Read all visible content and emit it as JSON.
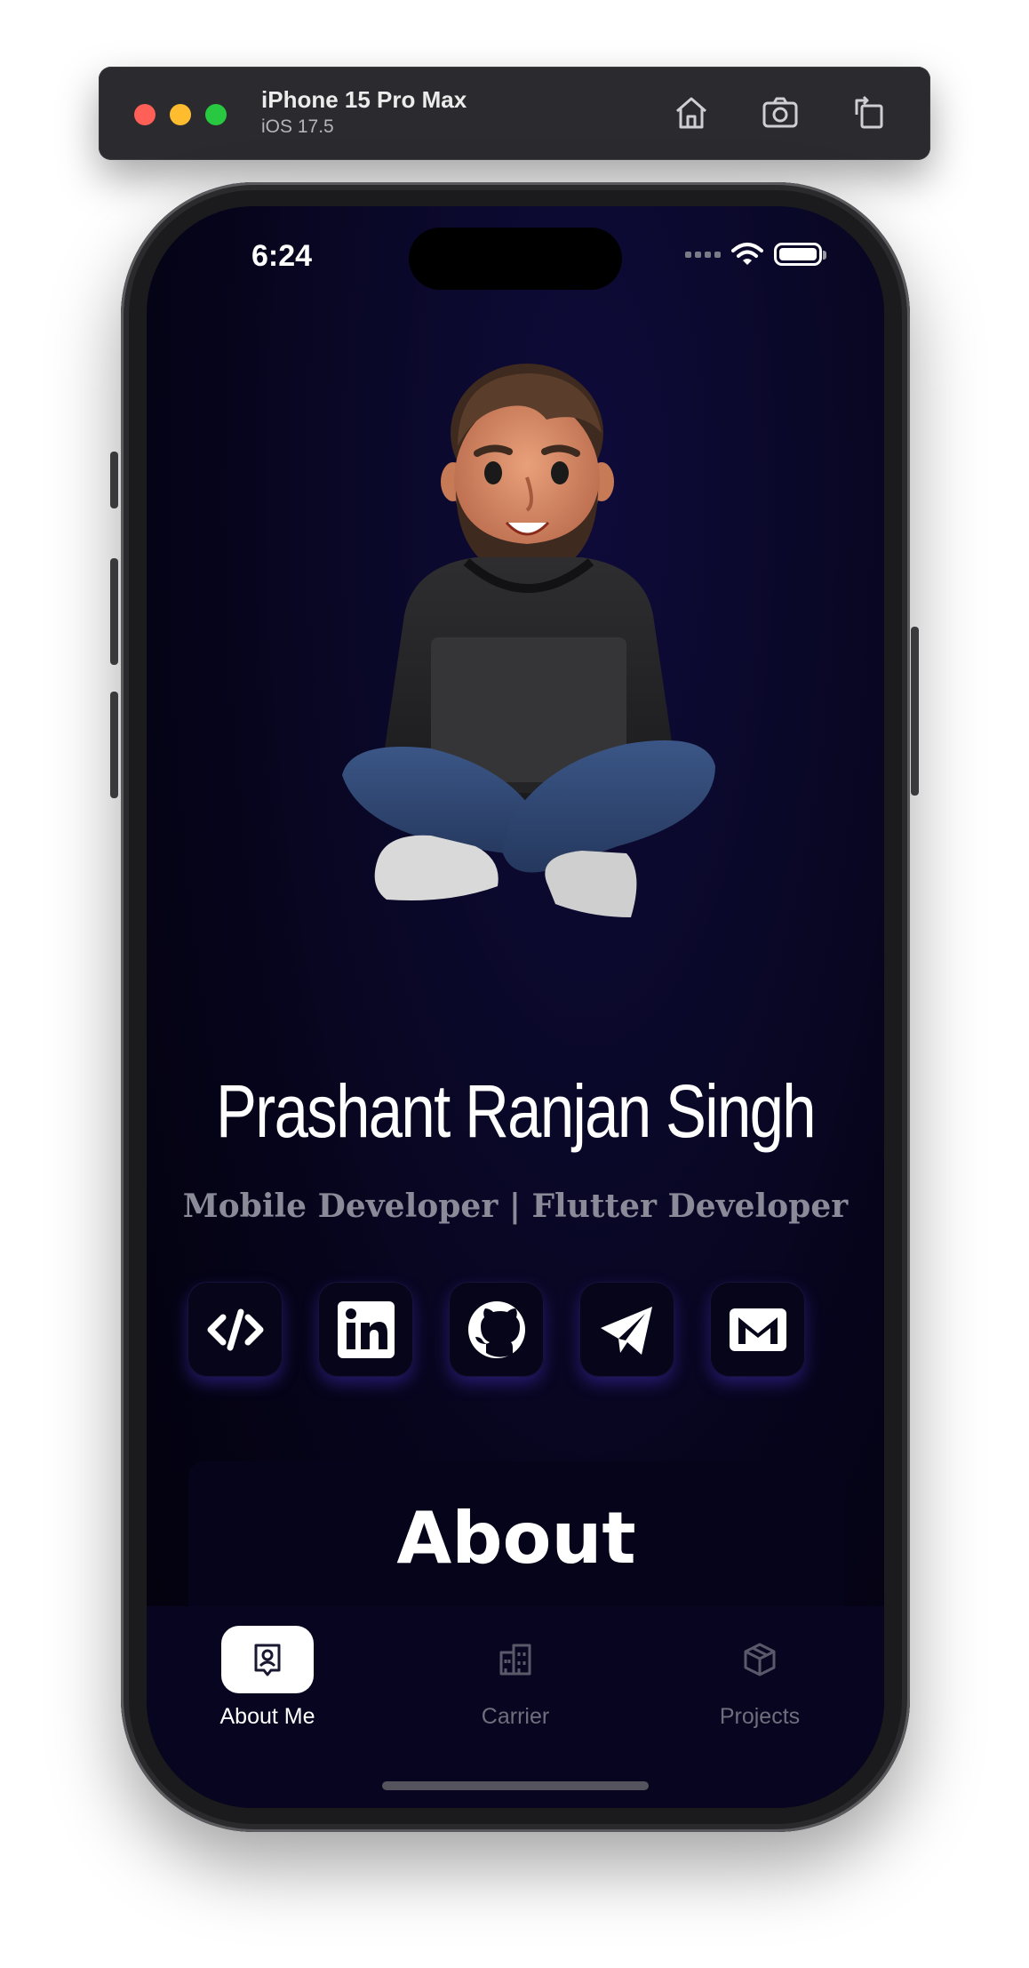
{
  "simulator": {
    "device_name": "iPhone 15 Pro Max",
    "os_version": "iOS 17.5",
    "icons": [
      "home-icon",
      "screenshot-icon",
      "rotate-icon"
    ]
  },
  "status_bar": {
    "time": "6:24",
    "icons": [
      "cellular-icon",
      "wifi-icon",
      "battery-icon"
    ]
  },
  "profile": {
    "name": "Prashant Ranjan Singh",
    "role": "Mobile Developer | Flutter Developer"
  },
  "socials": [
    {
      "icon": "code-icon"
    },
    {
      "icon": "linkedin-icon"
    },
    {
      "icon": "github-icon"
    },
    {
      "icon": "telegram-icon"
    },
    {
      "icon": "gmail-icon"
    }
  ],
  "about": {
    "title": "About"
  },
  "bottom_nav": {
    "items": [
      {
        "label": "About Me",
        "icon": "user-badge-icon",
        "active": true
      },
      {
        "label": "Carrier",
        "icon": "buildings-icon",
        "active": false
      },
      {
        "label": "Projects",
        "icon": "package-icon",
        "active": false
      }
    ]
  },
  "colors": {
    "screen_bg": "#0a0828",
    "accent_glow": "#4632c8",
    "text_primary": "#ffffff",
    "text_muted": "#8a8a99"
  }
}
